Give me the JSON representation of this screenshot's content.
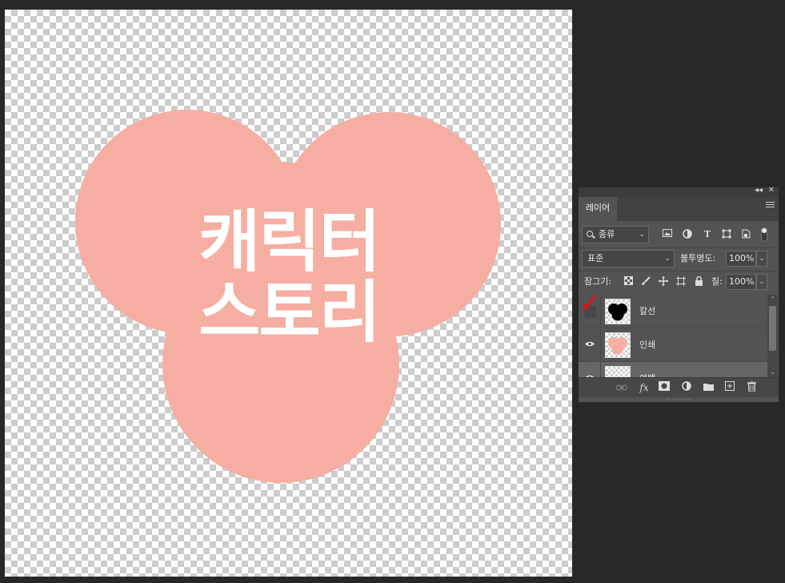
{
  "artwork": {
    "shape_color": "#f5aea1",
    "title_lines": [
      "캐릭터",
      "스토리"
    ]
  },
  "panel": {
    "tab": "레이어",
    "filter": {
      "label": "종류",
      "icons": [
        "image-filter-icon",
        "adjustment-filter-icon",
        "type-filter-icon",
        "shape-filter-icon",
        "smart-object-filter-icon",
        "filter-toggle"
      ]
    },
    "blend_mode": "표준",
    "opacity_label": "불투명도:",
    "opacity_value": "100%",
    "lock_label": "잠그기:",
    "lock_icons": [
      "lock-transparent-pixels-icon",
      "lock-image-pixels-icon",
      "lock-position-icon",
      "lock-artboard-icon",
      "lock-all-icon"
    ],
    "fill_label": "칠:",
    "fill_value": "100%",
    "layers": [
      {
        "name": "칼선",
        "visible": false,
        "annotation": "✓",
        "annotation_color": "#e0101a",
        "thumb": "black-heart"
      },
      {
        "name": "인쇄",
        "visible": true,
        "thumb": "pink-heart"
      },
      {
        "name": "여백",
        "visible": true,
        "thumb": "transparent"
      }
    ],
    "bottom_icons": [
      "link-layers-icon",
      "fx-icon",
      "add-mask-icon",
      "adjustment-layer-icon",
      "new-group-icon",
      "new-layer-icon",
      "delete-layer-icon"
    ]
  }
}
